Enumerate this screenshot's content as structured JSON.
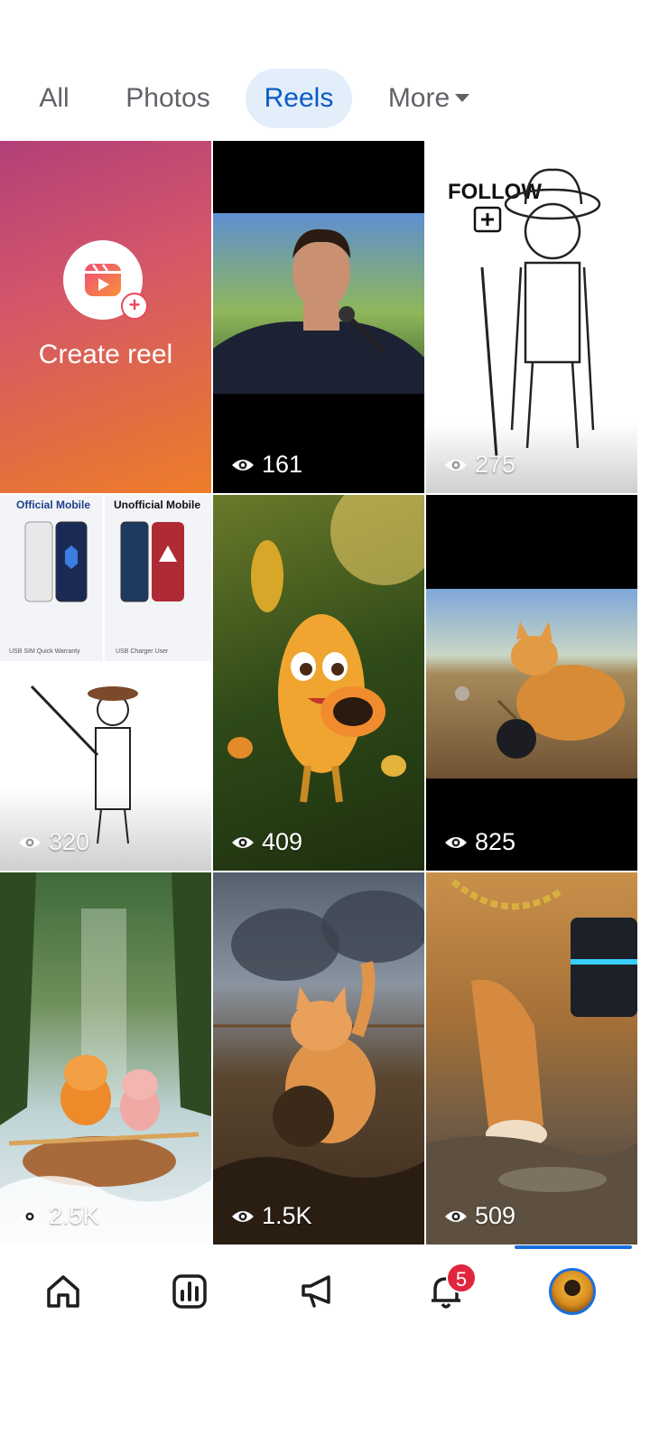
{
  "tabs": [
    {
      "label": "All"
    },
    {
      "label": "Photos"
    },
    {
      "label": "Reels"
    },
    {
      "label": "More"
    }
  ],
  "active_tab": "Reels",
  "create_reel": {
    "label": "Create reel",
    "icon": "reels-icon"
  },
  "reels": [
    {
      "views": "161"
    },
    {
      "views": "275",
      "overlay_text": "FOLLOW"
    },
    {
      "views": "320",
      "overlay_left": "Official Mobile",
      "overlay_right": "Unofficial Mobile"
    },
    {
      "views": "409"
    },
    {
      "views": "825"
    },
    {
      "views": "2.5K"
    },
    {
      "views": "1.5K"
    },
    {
      "views": "509"
    }
  ],
  "bottom_nav": {
    "items": [
      {
        "icon": "home-icon"
      },
      {
        "icon": "insights-icon"
      },
      {
        "icon": "megaphone-icon"
      },
      {
        "icon": "bell-icon",
        "badge": "5"
      },
      {
        "icon": "profile-avatar"
      }
    ]
  },
  "colors": {
    "accent": "#0a5bc4",
    "active_tab_bg": "#e3eefb",
    "badge": "#e0263f"
  }
}
